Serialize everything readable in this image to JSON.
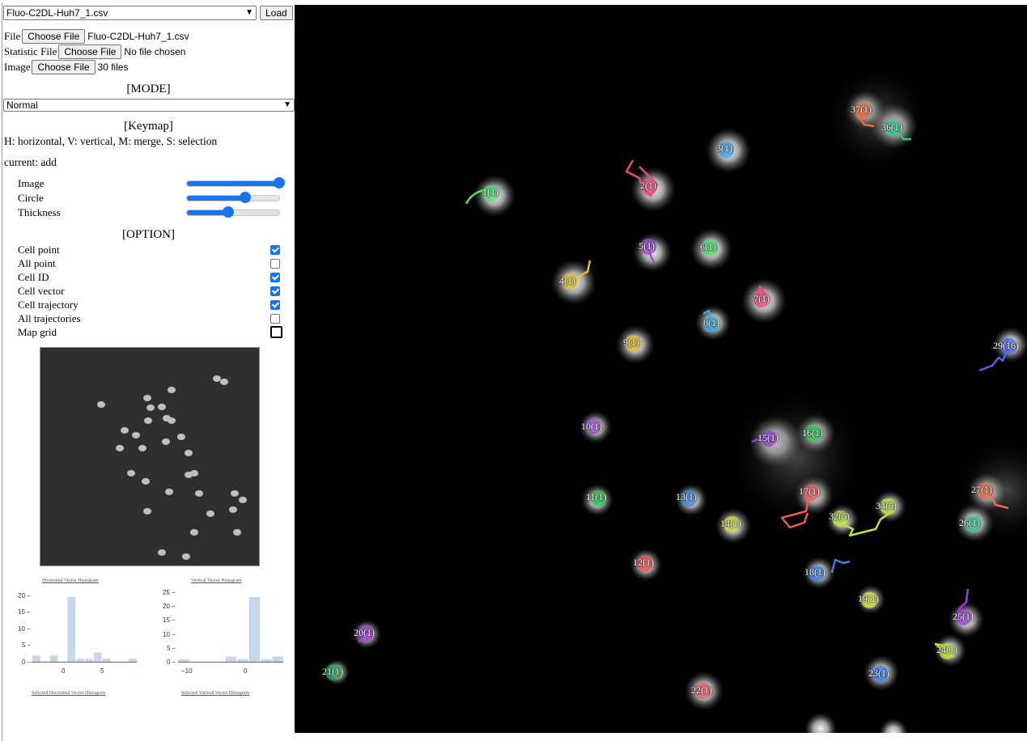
{
  "file_select": {
    "value": "Fluo-C2DL-Huh7_1.csv"
  },
  "load_button": "Load",
  "file_inputs": [
    {
      "label": "File",
      "button": "Choose File",
      "status": "Fluo-C2DL-Huh7_1.csv"
    },
    {
      "label": "Statistic File",
      "button": "Choose File",
      "status": "No file chosen"
    },
    {
      "label": "Image",
      "button": "Choose File",
      "status": "30 files"
    }
  ],
  "mode": {
    "heading": "[MODE]",
    "value": "Normal"
  },
  "keymap": {
    "heading": "[Keymap]",
    "text": "H: horizontal, V: vertical, M: merge, S: selection",
    "current": "current: add"
  },
  "sliders": [
    {
      "label": "Image",
      "value": 1.0
    },
    {
      "label": "Circle",
      "value": 0.63
    },
    {
      "label": "Thickness",
      "value": 0.45
    }
  ],
  "options": {
    "heading": "[OPTION]",
    "items": [
      {
        "label": "Cell point",
        "checked": true
      },
      {
        "label": "All point",
        "checked": false
      },
      {
        "label": "Cell ID",
        "checked": true
      },
      {
        "label": "Cell vector",
        "checked": true
      },
      {
        "label": "Cell trajectory",
        "checked": true
      },
      {
        "label": "All trajectories",
        "checked": false
      },
      {
        "label": "Map grid",
        "checked": false
      }
    ]
  },
  "histograms": {
    "horizontal_title": "Horizontal Vector Histogram",
    "vertical_title": "Vertical Vector Histogram",
    "selected_horizontal_title": "Selected Horizontal Vector Histogram",
    "selected_vertical_title": "Selected Vertical Vector Histogram",
    "horizontal_y_ticks": [
      "20 –",
      "15 –",
      "10 –",
      "5 –",
      "0 –"
    ],
    "horizontal_x_ticks": [
      "0",
      "5"
    ],
    "vertical_y_ticks": [
      "25 –",
      "20 –",
      "15 –",
      "10 –",
      "5 –",
      "0 –"
    ],
    "vertical_x_ticks": [
      "−10",
      "0"
    ]
  },
  "chart_data": [
    {
      "type": "bar",
      "title": "Horizontal Vector Histogram",
      "categories": [
        -3,
        -2,
        -1,
        0,
        1,
        2,
        3,
        4,
        5,
        6,
        7,
        8
      ],
      "values": [
        2,
        0,
        2,
        0,
        21,
        1,
        1,
        3,
        1,
        0,
        0,
        1
      ],
      "ylim": [
        0,
        21
      ]
    },
    {
      "type": "bar",
      "title": "Vertical Vector Histogram",
      "categories": [
        -12,
        -10,
        -8,
        -6,
        -4,
        -2,
        0,
        2,
        4
      ],
      "values": [
        1,
        0,
        0,
        0,
        2,
        1,
        25,
        1,
        2
      ],
      "ylim": [
        0,
        25
      ]
    }
  ],
  "cells": [
    {
      "label": "1(1)",
      "color": "#4ee26b"
    },
    {
      "label": "2(1)",
      "color": "#f0457a"
    },
    {
      "label": "3(1)",
      "color": "#3aa3e3"
    },
    {
      "label": "4(1)",
      "color": "#e3c02a"
    },
    {
      "label": "5(1)",
      "color": "#9a4fd6"
    },
    {
      "label": "6(1)",
      "color": "#4ee26b"
    },
    {
      "label": "7(1)",
      "color": "#f0457a"
    },
    {
      "label": "8(1)",
      "color": "#3aa3e3"
    },
    {
      "label": "9(1)",
      "color": "#e3c02a"
    },
    {
      "label": "10(1)",
      "color": "#9a4fd6"
    },
    {
      "label": "11(1)",
      "color": "#2ec95a"
    },
    {
      "label": "12(1)",
      "color": "#f04a4a"
    },
    {
      "label": "13(1)",
      "color": "#3a7fe3"
    },
    {
      "label": "14(1)",
      "color": "#d8d83a"
    },
    {
      "label": "15(1)",
      "color": "#9a3fd6"
    },
    {
      "label": "16(1)",
      "color": "#2ec95a"
    },
    {
      "label": "17(1)",
      "color": "#f05a5a"
    },
    {
      "label": "18(1)",
      "color": "#3a7fe3"
    },
    {
      "label": "19(1)",
      "color": "#d8e83a"
    },
    {
      "label": "20(1)",
      "color": "#9a3fd6"
    },
    {
      "label": "21(1)",
      "color": "#1fa85a"
    },
    {
      "label": "22(1)",
      "color": "#f05a5a"
    },
    {
      "label": "23(1)",
      "color": "#3a7fe3"
    },
    {
      "label": "24(1)",
      "color": "#b8e83a"
    },
    {
      "label": "25(1)",
      "color": "#9a3fd6"
    },
    {
      "label": "26(1)",
      "color": "#2ec98a"
    },
    {
      "label": "27(1)",
      "color": "#f06a4a"
    },
    {
      "label": "29(16)",
      "color": "#4a6ae3"
    },
    {
      "label": "32(5)",
      "color": "#b8e83a"
    },
    {
      "label": "34(5)",
      "color": "#b8e83a"
    },
    {
      "label": "36(1)",
      "color": "#2ec98a"
    },
    {
      "label": "37(1)",
      "color": "#f06a3a"
    }
  ]
}
